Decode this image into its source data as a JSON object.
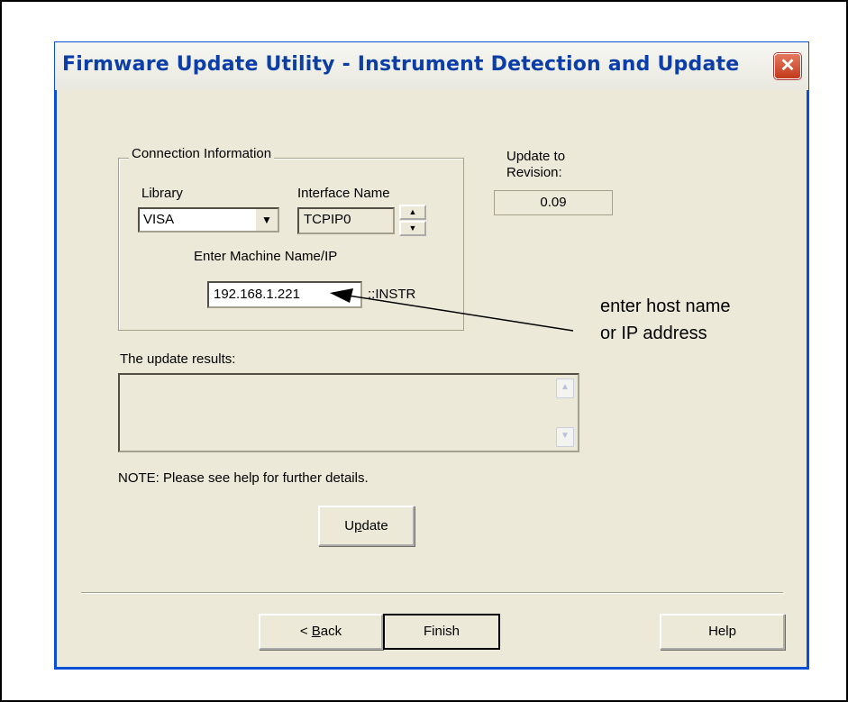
{
  "window": {
    "title": "Firmware Update Utility - Instrument Detection and Update",
    "close_glyph": "✕"
  },
  "connection": {
    "group_label": "Connection Information",
    "library_label": "Library",
    "library_value": "VISA",
    "interface_label": "Interface Name",
    "interface_value": "TCPIP0",
    "machine_label": "Enter Machine Name/IP",
    "machine_value": "192.168.1.221",
    "suffix": "::INSTR"
  },
  "revision": {
    "label_line1": "Update to",
    "label_line2": "Revision:",
    "value": "0.09"
  },
  "results": {
    "label": "The update results:",
    "value": ""
  },
  "note": "NOTE: Please see help for further details.",
  "buttons": {
    "update_pre": "U",
    "update_ul": "p",
    "update_post": "date",
    "back_pre": "< ",
    "back_ul": "B",
    "back_post": "ack",
    "finish": "Finish",
    "help": "Help"
  },
  "annotation": {
    "line1": "enter host name",
    "line2": "or IP address"
  },
  "icons": {
    "combo_arrow": "▼",
    "spin_up": "▲",
    "spin_down": "▼",
    "scroll_up": "▲",
    "scroll_down": "▼"
  }
}
